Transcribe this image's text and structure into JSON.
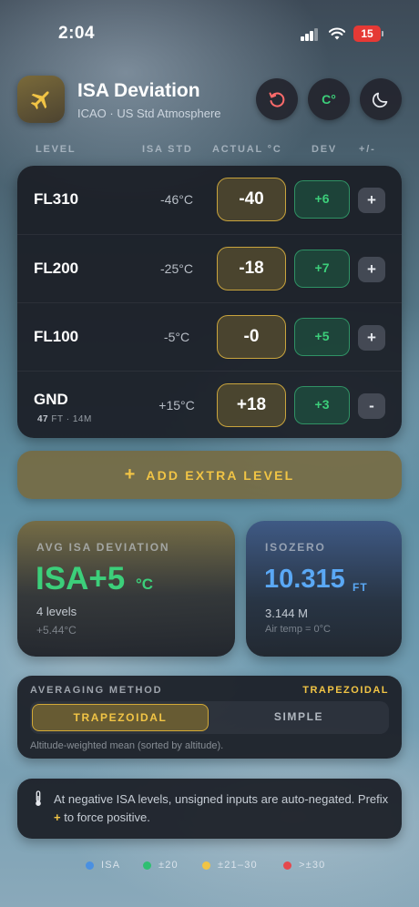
{
  "status": {
    "time": "2:04",
    "battery": "15"
  },
  "header": {
    "title": "ISA Deviation",
    "subtitle": "ICAO · US Std Atmosphere",
    "unit_toggle": "C°"
  },
  "columns": {
    "level": "LEVEL",
    "isa_std": "ISA STD",
    "actual": "ACTUAL °C",
    "dev": "DEV",
    "sign": "+/-"
  },
  "rows": [
    {
      "level": "FL310",
      "isa": "-46°C",
      "actual": "-40",
      "dev": "+6",
      "sign": "+"
    },
    {
      "level": "FL200",
      "isa": "-25°C",
      "actual": "-18",
      "dev": "+7",
      "sign": "+"
    },
    {
      "level": "FL100",
      "isa": "-5°C",
      "actual": "-0",
      "dev": "+5",
      "sign": "+"
    },
    {
      "level": "GND",
      "elev_ft": "47",
      "elev_ft_unit": "FT",
      "elev_m": "· 14M",
      "isa": "+15°C",
      "actual": "+18",
      "dev": "+3",
      "sign": "-"
    }
  ],
  "add_level": {
    "plus": "+",
    "label": "ADD EXTRA LEVEL"
  },
  "avg_card": {
    "title": "AVG ISA DEVIATION",
    "value": "ISA+5",
    "unit": "°C",
    "line1": "4 levels",
    "line2": "+5.44°C"
  },
  "iso_card": {
    "title": "ISOZERO",
    "value": "10.315",
    "unit": "FT",
    "line1": "3.144 M",
    "line2": "Air temp = 0°C"
  },
  "method": {
    "label": "AVERAGING METHOD",
    "current": "TRAPEZOIDAL",
    "options": [
      "TRAPEZOIDAL",
      "SIMPLE"
    ],
    "description": "Altitude-weighted mean (sorted by altitude)."
  },
  "note": {
    "text_before": "At negative ISA levels, unsigned inputs are auto-negated. Prefix ",
    "highlight": "+",
    "text_after": " to force positive."
  },
  "legend": [
    {
      "label": "ISA",
      "color": "#4a90e2"
    },
    {
      "label": "±20",
      "color": "#2fbf71"
    },
    {
      "label": "±21–30",
      "color": "#f1c445"
    },
    {
      "label": ">±30",
      "color": "#e5484d"
    }
  ],
  "colors": {
    "accent_gold": "#f1c445",
    "positive_green": "#3ccf7a",
    "isozero_blue": "#5aa8f5"
  }
}
